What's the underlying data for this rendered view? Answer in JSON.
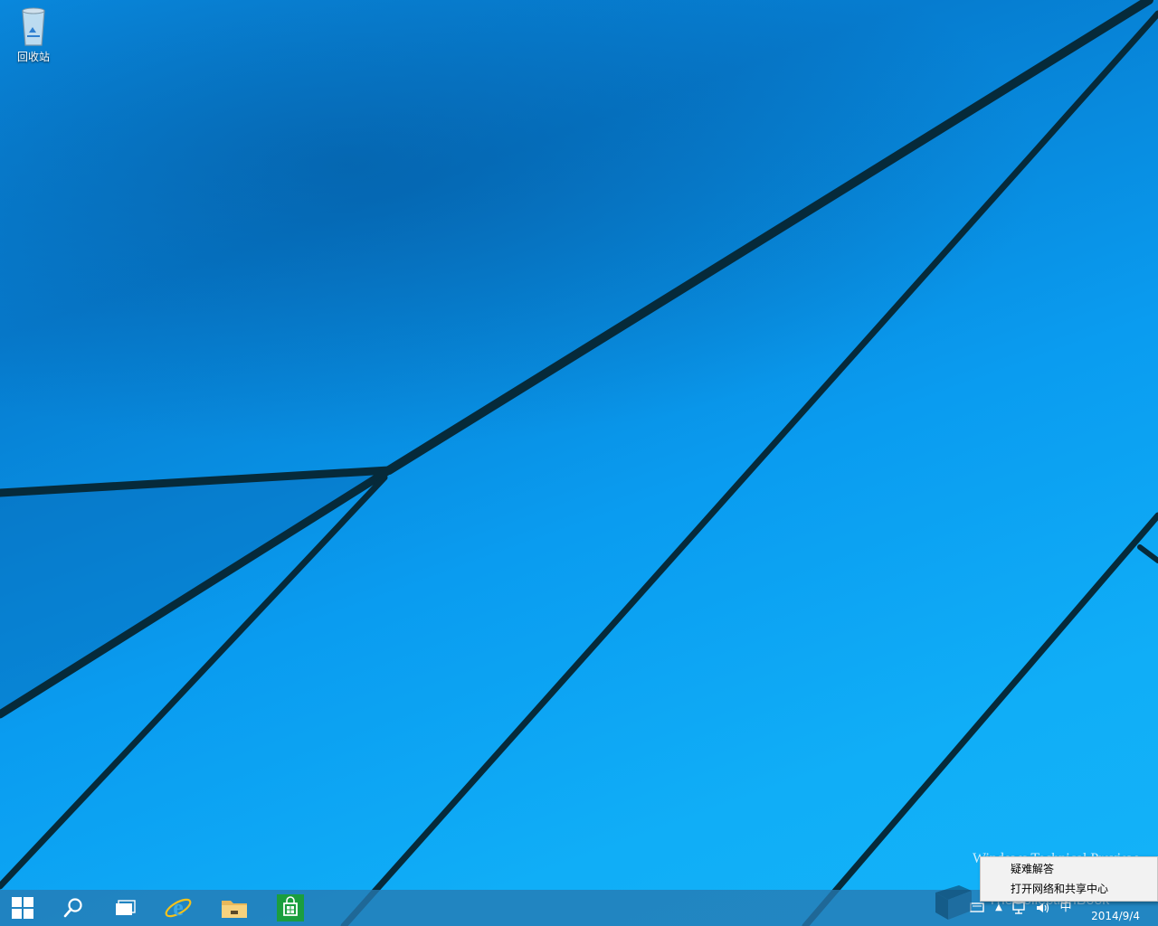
{
  "desktop": {
    "icons": [
      {
        "label": "回收站",
        "icon": "recycle-bin-icon"
      }
    ],
    "build_watermark": "Windows Technical Preview"
  },
  "taskbar": {
    "buttons": [
      {
        "name": "start",
        "icon": "windows-logo-icon"
      },
      {
        "name": "search",
        "icon": "search-icon"
      },
      {
        "name": "task-view",
        "icon": "task-view-icon"
      },
      {
        "name": "internet-explorer",
        "icon": "internet-explorer-icon"
      },
      {
        "name": "file-explorer",
        "icon": "folder-icon"
      },
      {
        "name": "store",
        "icon": "store-icon"
      }
    ],
    "tray": {
      "ime_label": "中",
      "clock_date": "2014/9/4"
    }
  },
  "context_menu": {
    "items": [
      {
        "label": "疑难解答"
      },
      {
        "label": "打开网络和共享中心"
      }
    ]
  },
  "overlay_watermark": "TheCollectionBook",
  "colors": {
    "desktop_blue": "#0a9cf0",
    "taskbar": "#267ab2",
    "menu_bg": "#f2f2f2",
    "store_green": "#1b9e3e"
  }
}
